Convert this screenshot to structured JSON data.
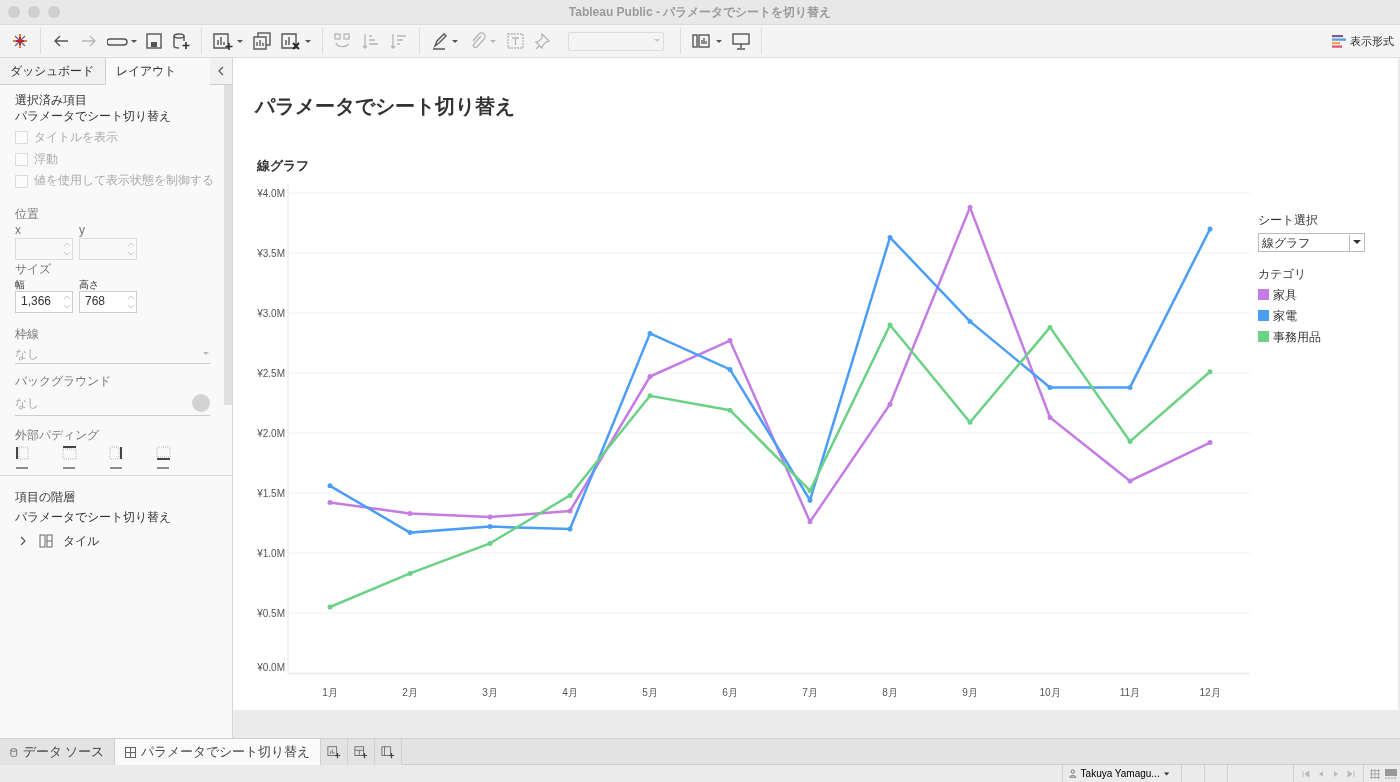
{
  "window": {
    "title": "Tableau Public - パラメータでシートを切り替え"
  },
  "toolbar": {
    "show_me": "表示形式"
  },
  "side_panel": {
    "tabs": [
      {
        "label": "ダッシュボード",
        "selected": false
      },
      {
        "label": "レイアウト",
        "selected": true
      }
    ],
    "selected_item": {
      "heading": "選択済み項目",
      "name": "パラメータでシート切り替え"
    },
    "options": [
      {
        "label": "タイトルを表示",
        "checked": false,
        "disabled": true
      },
      {
        "label": "浮動",
        "checked": false,
        "disabled": true
      },
      {
        "label": "値を使用して表示状態を制御する",
        "checked": false,
        "disabled": true
      }
    ],
    "position": {
      "label": "位置",
      "fields": [
        {
          "label": "x",
          "disabled": true
        },
        {
          "label": "y",
          "disabled": true
        }
      ]
    },
    "size": {
      "label": "サイズ",
      "fields": [
        {
          "label": "幅",
          "value": "1,366",
          "disabled": false
        },
        {
          "label": "高さ",
          "value": "768",
          "disabled": false
        }
      ]
    },
    "border": {
      "label": "枠線",
      "value": "なし"
    },
    "background": {
      "label": "バックグラウンド",
      "value": "なし"
    },
    "outer_padding": {
      "label": "外部パディング"
    },
    "hierarchy": {
      "heading": "項目の階層",
      "root": "パラメータでシート切り替え",
      "children": [
        {
          "label": "タイル",
          "expanded": false
        }
      ]
    }
  },
  "dashboard": {
    "title": "パラメータでシート切り替え",
    "sheet_title": "線グラフ",
    "chart_data": {
      "type": "line",
      "grid": true,
      "categories": [
        "1月",
        "2月",
        "3月",
        "4月",
        "5月",
        "6月",
        "7月",
        "8月",
        "9月",
        "10月",
        "11月",
        "12月"
      ],
      "ylim": [
        0,
        4
      ],
      "yticks": [
        {
          "value": 0,
          "label": "¥0.0M"
        },
        {
          "value": 0.5,
          "label": "¥0.5M"
        },
        {
          "value": 1,
          "label": "¥1.0M"
        },
        {
          "value": 1.5,
          "label": "¥1.5M"
        },
        {
          "value": 2,
          "label": "¥2.0M"
        },
        {
          "value": 2.5,
          "label": "¥2.5M"
        },
        {
          "value": 3,
          "label": "¥3.0M"
        },
        {
          "value": 3.5,
          "label": "¥3.5M"
        },
        {
          "value": 4,
          "label": "¥4.0M"
        }
      ],
      "series": [
        {
          "name": "家具",
          "color": "#c47ce4",
          "values": [
            1.42,
            1.33,
            1.3,
            1.35,
            2.47,
            2.77,
            1.26,
            2.24,
            3.88,
            2.13,
            1.6,
            1.92
          ]
        },
        {
          "name": "家電",
          "color": "#4b9ef7",
          "values": [
            1.56,
            1.17,
            1.22,
            1.2,
            2.83,
            2.53,
            1.44,
            3.63,
            2.93,
            2.38,
            2.38,
            3.7
          ]
        },
        {
          "name": "事務用品",
          "color": "#6ad185",
          "values": [
            0.55,
            0.83,
            1.08,
            1.48,
            2.31,
            2.19,
            1.52,
            2.9,
            2.09,
            2.88,
            1.93,
            2.51
          ]
        }
      ]
    },
    "parameter": {
      "label": "シート選択",
      "value": "線グラフ"
    },
    "legend": {
      "title": "カテゴリ"
    }
  },
  "sheet_tabs": [
    {
      "label": "データ ソース",
      "kind": "datasource",
      "selected": false
    },
    {
      "label": "パラメータでシート切り替え",
      "kind": "dashboard",
      "selected": true
    }
  ],
  "status_bar": {
    "user": "Takuya Yamagu..."
  }
}
